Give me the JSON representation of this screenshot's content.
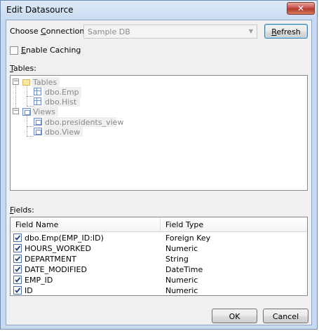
{
  "window": {
    "title": "Edit Datasource",
    "close_symbol": "✕"
  },
  "connection": {
    "label_prefix": "Choose ",
    "label_accel": "C",
    "label_suffix": "onnection:",
    "value": "Sample DB",
    "refresh_accel": "R",
    "refresh_rest": "efresh"
  },
  "caching": {
    "label_accel": "E",
    "label_rest": "nable Caching",
    "checked": false
  },
  "tables_section": {
    "label_accel": "T",
    "label_rest": "ables:",
    "tree": {
      "tables_node": "Tables",
      "tables_children": [
        "dbo.Emp",
        "dbo.Hist"
      ],
      "views_node": "Views",
      "views_children": [
        "dbo.presidents_view",
        "dbo.View"
      ]
    }
  },
  "fields_section": {
    "label_accel": "F",
    "label_rest": "ields:",
    "columns": [
      "Field Name",
      "Field Type"
    ],
    "rows": [
      {
        "name": "dbo.Emp(EMP_ID:ID)",
        "type": "Foreign Key",
        "checked": true
      },
      {
        "name": "HOURS_WORKED",
        "type": "Numeric",
        "checked": true
      },
      {
        "name": "DEPARTMENT",
        "type": "String",
        "checked": true
      },
      {
        "name": "DATE_MODIFIED",
        "type": "DateTime",
        "checked": true
      },
      {
        "name": "EMP_ID",
        "type": "Numeric",
        "checked": true
      },
      {
        "name": "ID",
        "type": "Numeric",
        "checked": true
      }
    ]
  },
  "buttons": {
    "ok": "OK",
    "cancel": "Cancel"
  }
}
